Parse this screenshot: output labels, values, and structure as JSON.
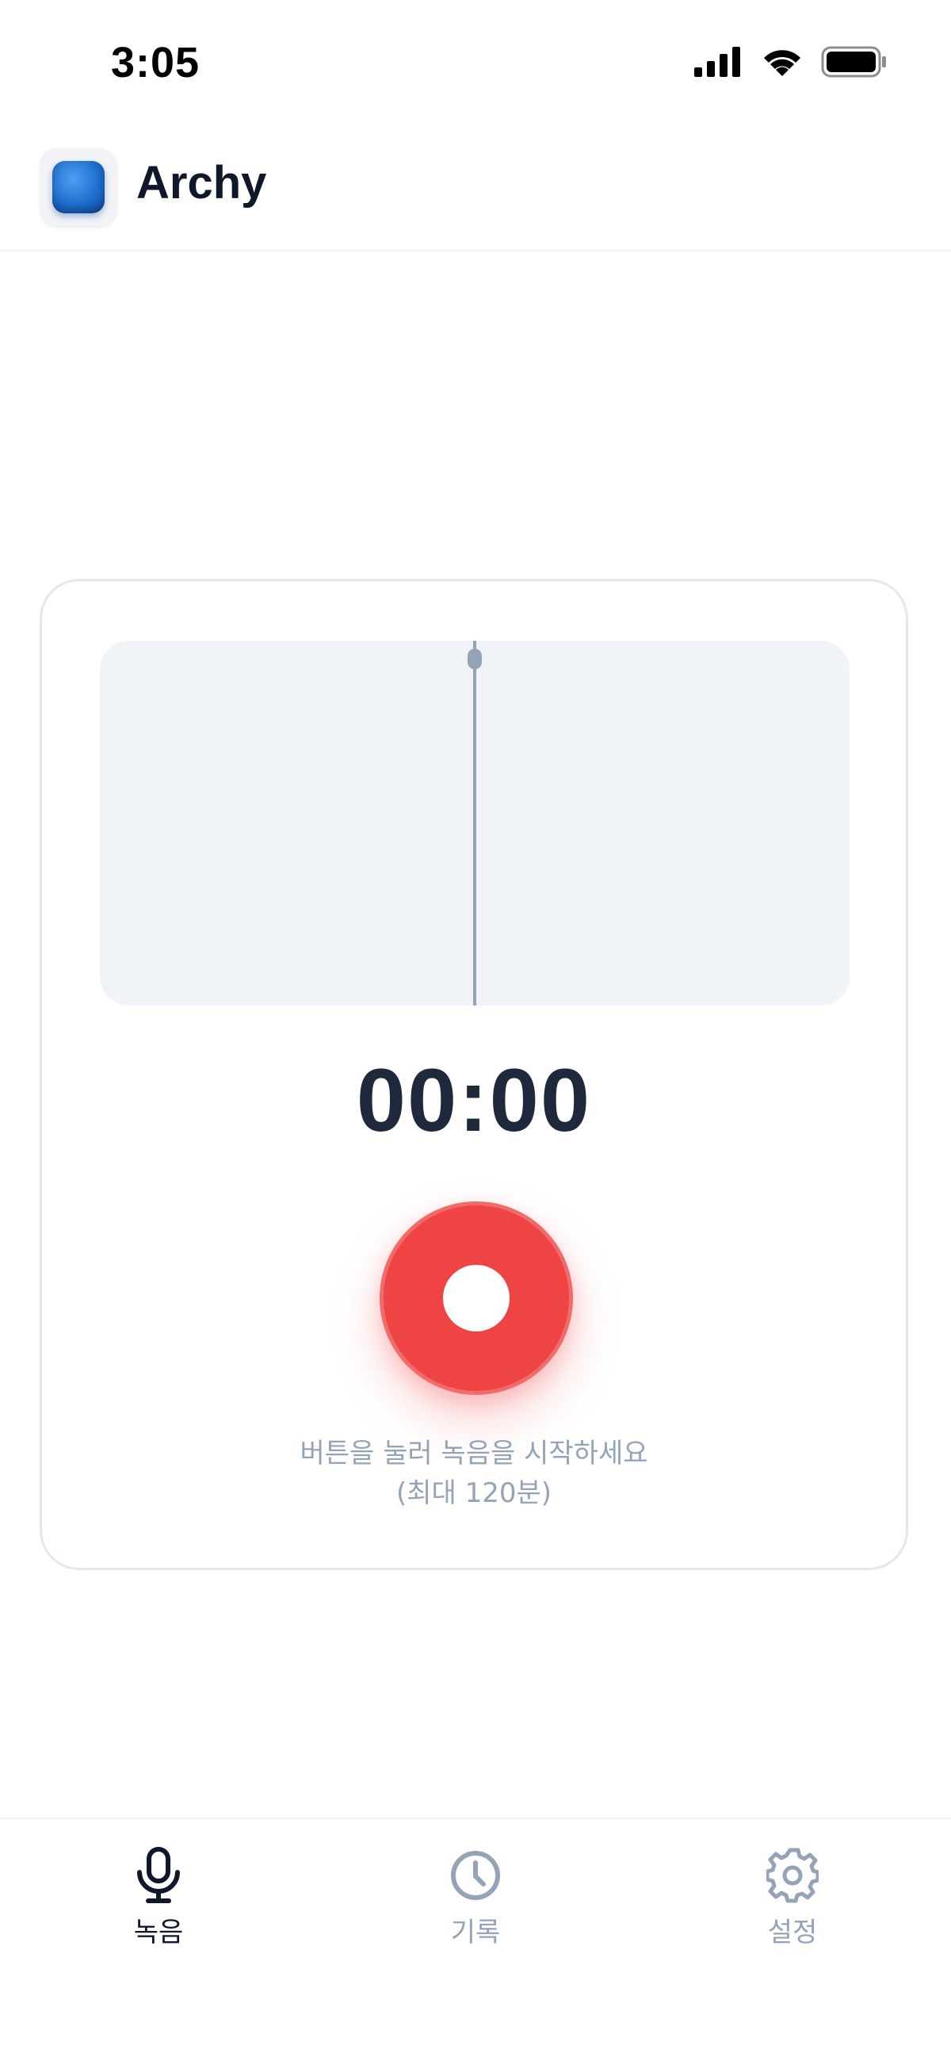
{
  "status_bar": {
    "time": "3:05",
    "icons": [
      "signal-icon",
      "wifi-icon",
      "battery-icon"
    ]
  },
  "header": {
    "app_name": "Archy",
    "logo_icon": "app-logo-icon"
  },
  "recorder": {
    "timer": "00:00",
    "hint_line1": "버튼을 눌러 녹음을 시작하세요",
    "hint_line2": "(최대 120분)",
    "record_button_icon": "record-icon"
  },
  "tabs": [
    {
      "label": "녹음",
      "icon": "microphone-icon",
      "active": true
    },
    {
      "label": "기록",
      "icon": "clock-icon",
      "active": false
    },
    {
      "label": "설정",
      "icon": "gear-icon",
      "active": false
    }
  ],
  "colors": {
    "accent": "#ef4444",
    "text_primary": "#1e293b",
    "text_muted": "#94a3b8",
    "waveform_bg": "#f0f4f8"
  }
}
